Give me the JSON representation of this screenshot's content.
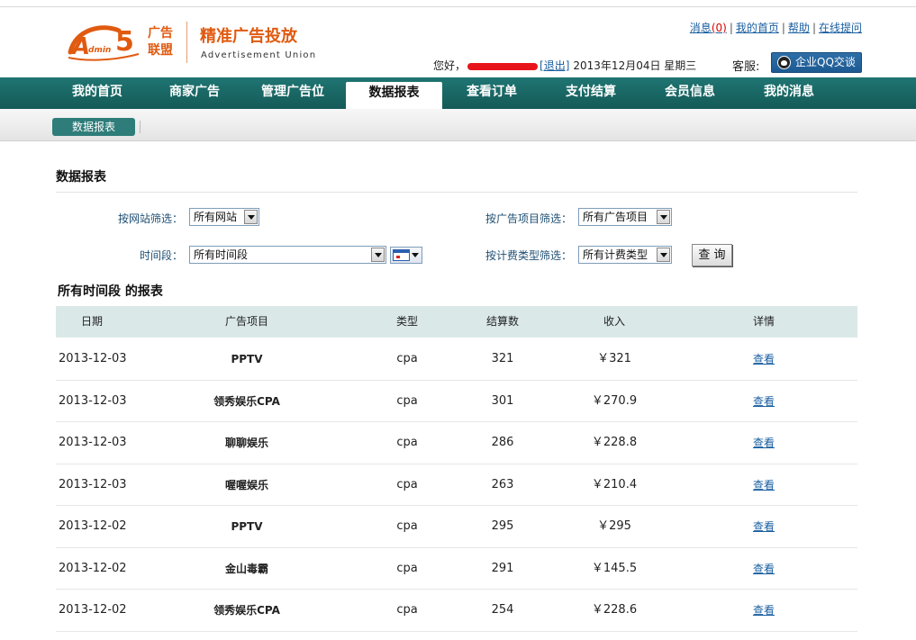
{
  "header": {
    "logo_text": "Admin5",
    "logo_cn": "广告联盟",
    "slogan": "精准广告投放",
    "slogan_en": "Advertisement Union",
    "top_links": {
      "messages": "消息",
      "messages_count": "(0)",
      "home": "我的首页",
      "help": "帮助",
      "ask_online": "在线提问"
    },
    "greeting": "您好，",
    "logout": "[退出]",
    "date": "2013年12月04日 星期三",
    "kefu_label": "客服:",
    "qq_button": "企业QQ交谈"
  },
  "nav": {
    "items": [
      {
        "label": "我的首页"
      },
      {
        "label": "商家广告"
      },
      {
        "label": "管理广告位"
      },
      {
        "label": "数据报表",
        "active": true
      },
      {
        "label": "查看订单"
      },
      {
        "label": "支付结算"
      },
      {
        "label": "会员信息"
      },
      {
        "label": "我的消息"
      }
    ]
  },
  "subnav": {
    "tab": "数据报表"
  },
  "main": {
    "section_title": "数据报表",
    "filters": {
      "site_label": "按网站筛选：",
      "site_value": "所有网站",
      "project_label": "按广告项目筛选：",
      "project_value": "所有广告项目",
      "period_label": "时间段：",
      "period_value": "所有时间段",
      "fee_label": "按计费类型筛选：",
      "fee_value": "所有计费类型",
      "query_button": "查 询"
    },
    "report_title": "所有时间段 的报表",
    "table": {
      "headers": [
        "日期",
        "广告项目",
        "类型",
        "结算数",
        "收入",
        "详情"
      ],
      "rows": [
        {
          "date": "2013-12-03",
          "name": "PPTV",
          "type": "cpa",
          "count": "321",
          "income": "￥321",
          "detail": "查看"
        },
        {
          "date": "2013-12-03",
          "name": "领秀娱乐CPA",
          "type": "cpa",
          "count": "301",
          "income": "￥270.9",
          "detail": "查看"
        },
        {
          "date": "2013-12-03",
          "name": "聊聊娱乐",
          "type": "cpa",
          "count": "286",
          "income": "￥228.8",
          "detail": "查看"
        },
        {
          "date": "2013-12-03",
          "name": "喔喔娱乐",
          "type": "cpa",
          "count": "263",
          "income": "￥210.4",
          "detail": "查看"
        },
        {
          "date": "2013-12-02",
          "name": "PPTV",
          "type": "cpa",
          "count": "295",
          "income": "￥295",
          "detail": "查看"
        },
        {
          "date": "2013-12-02",
          "name": "金山毒霸",
          "type": "cpa",
          "count": "291",
          "income": "￥145.5",
          "detail": "查看"
        },
        {
          "date": "2013-12-02",
          "name": "领秀娱乐CPA",
          "type": "cpa",
          "count": "254",
          "income": "￥228.6",
          "detail": "查看"
        }
      ]
    }
  },
  "colors": {
    "nav_bg": "#1f7572",
    "brand_orange": "#e05a10",
    "link_blue": "#1a5fa0",
    "table_header_bg": "#dbe8e8"
  }
}
